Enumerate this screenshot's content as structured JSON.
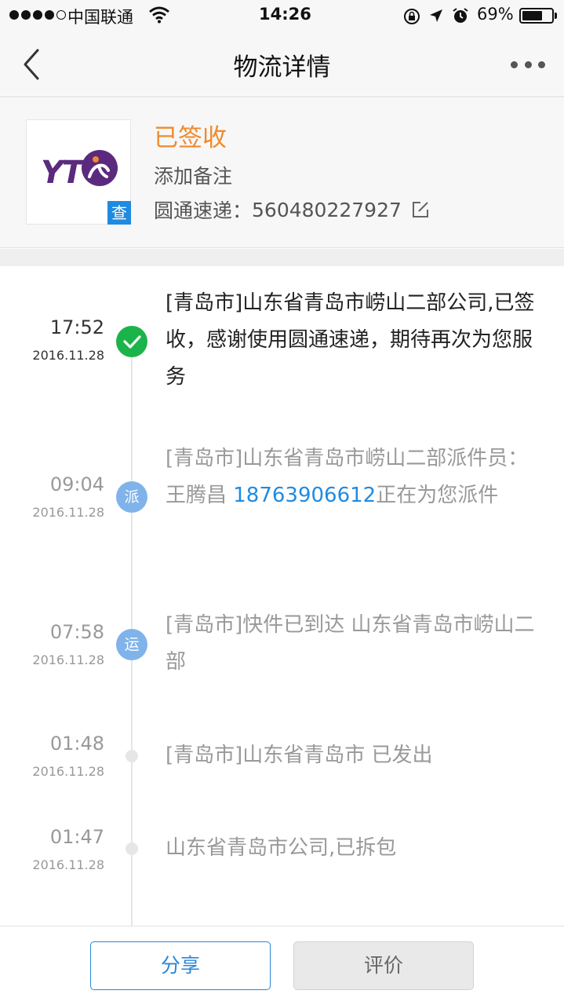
{
  "status_bar": {
    "carrier": "中国联通",
    "time": "14:26",
    "battery_percent": "69%",
    "battery_level": 0.69,
    "signal_icon": "signal-dots-icon",
    "wifi_icon": "wifi-icon"
  },
  "nav": {
    "title": "物流详情",
    "back_icon": "chevron-left-icon",
    "more_icon": "more-dots-icon"
  },
  "package": {
    "status": "已签收",
    "remark": "添加备注",
    "carrier_label": "圆通速递：",
    "tracking_number": "560480227927",
    "query_badge": "查",
    "logo_text": "YT",
    "status_color": "#f08a2c"
  },
  "timeline": [
    {
      "time": "17:52",
      "date": "2016.11.28",
      "marker": "✓",
      "marker_type": "done",
      "text": "[青岛市]山东省青岛市崂山二部公司,已签收，感谢使用圆通速递，期待再次为您服务"
    },
    {
      "time": "09:04",
      "date": "2016.11.28",
      "marker": "派",
      "marker_type": "blue",
      "text_before": "[青岛市]山东省青岛市崂山二部派件员：王腾昌 ",
      "phone": "18763906612",
      "text_after": "正在为您派件"
    },
    {
      "time": "07:58",
      "date": "2016.11.28",
      "marker": "运",
      "marker_type": "blue",
      "text": "[青岛市]快件已到达 山东省青岛市崂山二部"
    },
    {
      "time": "01:48",
      "date": "2016.11.28",
      "marker": "",
      "marker_type": "small",
      "text": "[青岛市]山东省青岛市 已发出"
    },
    {
      "time": "01:47",
      "date": "2016.11.28",
      "marker": "",
      "marker_type": "small",
      "text": "山东省青岛市公司,已拆包"
    }
  ],
  "actions": {
    "share": "分享",
    "rate": "评价"
  },
  "colors": {
    "accent_blue": "#1f8be0",
    "done_green": "#1bb44a",
    "marker_blue": "#7fb3ea"
  }
}
